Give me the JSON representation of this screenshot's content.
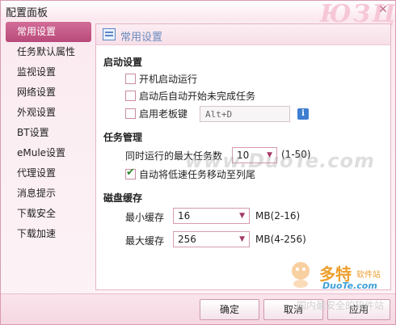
{
  "window": {
    "title": "配置面板",
    "brand_art": "ЮЗЦ"
  },
  "sidebar": {
    "items": [
      {
        "label": "常用设置",
        "active": true
      },
      {
        "label": "任务默认属性"
      },
      {
        "label": "监视设置"
      },
      {
        "label": "网络设置"
      },
      {
        "label": "外观设置"
      },
      {
        "label": "BT设置"
      },
      {
        "label": "eMule设置"
      },
      {
        "label": "代理设置"
      },
      {
        "label": "消息提示"
      },
      {
        "label": "下载安全"
      },
      {
        "label": "下载加速"
      }
    ]
  },
  "content": {
    "header_title": "常用设置",
    "startup": {
      "title": "启动设置",
      "auto_start": {
        "label": "开机启动运行",
        "checked": false
      },
      "auto_resume": {
        "label": "启动后自动开始未完成任务",
        "checked": false
      },
      "boss_key": {
        "label": "启用老板键",
        "checked": false,
        "value": "Alt+D"
      }
    },
    "tasks": {
      "title": "任务管理",
      "max_tasks_label": "同时运行的最大任务数",
      "max_tasks_value": "10",
      "max_tasks_range": "(1-50)",
      "move_slow": {
        "label": "自动将低速任务移动至列尾",
        "checked": true
      }
    },
    "cache": {
      "title": "磁盘缓存",
      "min_label": "最小缓存",
      "min_value": "16",
      "min_unit": "MB(2-16)",
      "max_label": "最大缓存",
      "max_value": "256",
      "max_unit": "MB(4-256)"
    }
  },
  "footer": {
    "ok_label": "确定",
    "cancel_label": "取消",
    "apply_label": "应用"
  },
  "watermark": {
    "center": "www.DuoTe.com",
    "brand": "多特",
    "brand_sub": "软件站",
    "url": "DuoTe.com",
    "slogan": "国内最安全的软件站"
  },
  "icons": {
    "close": "close-icon",
    "info": "info-icon",
    "header": "settings-page-icon"
  },
  "colors": {
    "accent": "#b84a79",
    "info_blue": "#3f7ed0"
  }
}
